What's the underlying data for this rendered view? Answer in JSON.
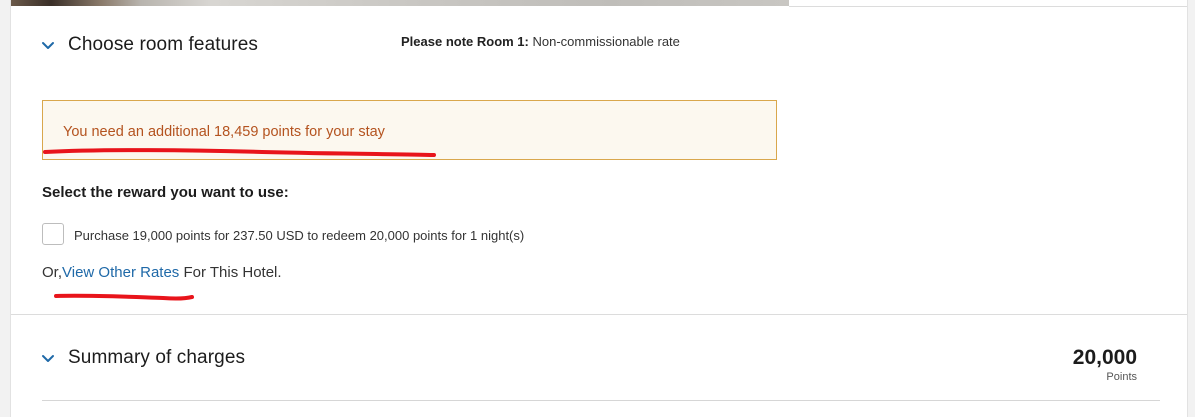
{
  "sections": {
    "room_features": {
      "title": "Choose room features",
      "icon": "chevron-down-icon"
    },
    "summary": {
      "title": "Summary of charges",
      "icon": "chevron-down-icon"
    }
  },
  "note": {
    "label": "Please note Room 1:",
    "value": "Non-commissionable rate"
  },
  "alert": {
    "message": "You need an additional 18,459 points for your stay"
  },
  "reward": {
    "heading": "Select the reward you want to use:",
    "option_label": "Purchase 19,000 points for 237.50 USD to redeem 20,000 points for 1 night(s)",
    "option_checked": false
  },
  "other_rates": {
    "prefix": "Or,",
    "link": "View Other Rates",
    "suffix": " For This Hotel."
  },
  "summary_total": {
    "value": "20,000",
    "unit": "Points"
  },
  "colors": {
    "alert_text": "#b4531f",
    "alert_border": "#d9a74c",
    "alert_bg": "#fcf8ef",
    "link": "#1f69a8",
    "chevron": "#1f69a8",
    "annotation": "#e8141b"
  }
}
